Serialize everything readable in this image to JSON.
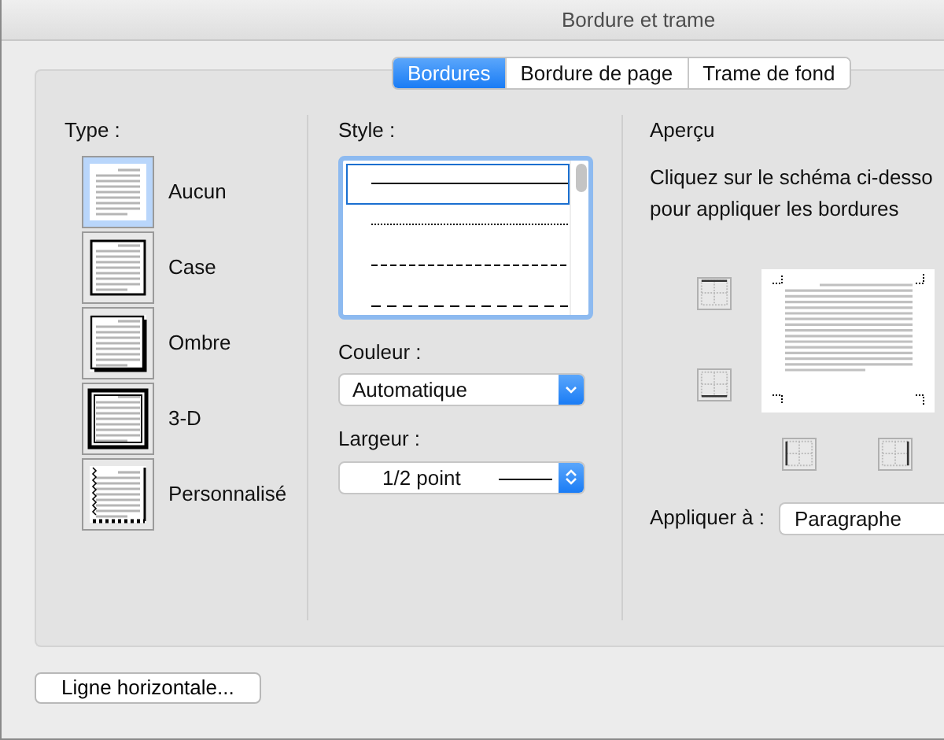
{
  "window": {
    "title": "Bordure et trame"
  },
  "tabs": [
    {
      "label": "Bordures",
      "selected": true
    },
    {
      "label": "Bordure de page",
      "selected": false
    },
    {
      "label": "Trame de fond",
      "selected": false
    }
  ],
  "type": {
    "label": "Type :",
    "options": [
      {
        "label": "Aucun",
        "kind": "none",
        "selected": true
      },
      {
        "label": "Case",
        "kind": "box",
        "selected": false
      },
      {
        "label": "Ombre",
        "kind": "shadow",
        "selected": false
      },
      {
        "label": "3-D",
        "kind": "raised",
        "selected": false
      },
      {
        "label": "Personnalisé",
        "kind": "custom",
        "selected": false
      }
    ]
  },
  "style": {
    "label": "Style :",
    "lines": [
      {
        "kind": "solid",
        "selected": true
      },
      {
        "kind": "dotted",
        "selected": false
      },
      {
        "kind": "dashed",
        "selected": false
      },
      {
        "kind": "longdash",
        "selected": false
      }
    ]
  },
  "color": {
    "label": "Couleur :",
    "value": "Automatique"
  },
  "width": {
    "label": "Largeur :",
    "value": "1/2 point"
  },
  "preview": {
    "heading": "Aperçu",
    "instructions": "Cliquez sur le schéma ci-desso\npour appliquer les bordures",
    "border_buttons": [
      {
        "kind": "top"
      },
      {
        "kind": "bottom"
      },
      {
        "kind": "left"
      },
      {
        "kind": "right"
      }
    ]
  },
  "apply_to": {
    "label": "Appliquer à :",
    "value": "Paragraphe"
  },
  "buttons": [
    "Ligne horizontale..."
  ]
}
